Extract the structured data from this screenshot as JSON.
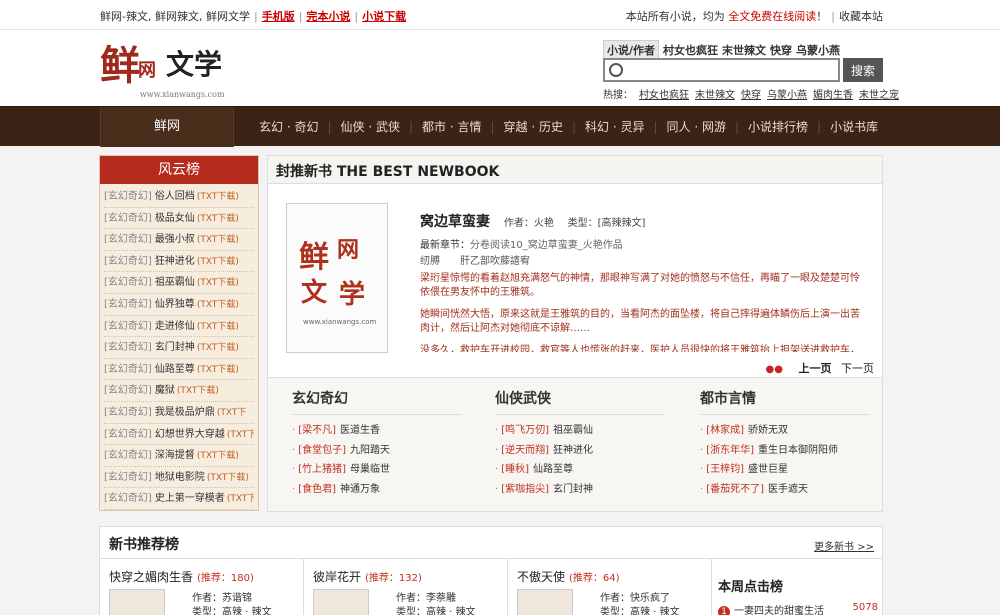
{
  "topbar": {
    "site_links": "鲜网-辣文, 鲜网辣文, 鲜网文学",
    "mobile": "手机版",
    "complete": "完本小说",
    "download": "小说下载",
    "notice_prefix": "本站所有小说，均为",
    "notice_free": "全文免费在线阅读",
    "notice_suffix": "！",
    "bookmark": "收藏本站"
  },
  "logo": {
    "char1": "鲜",
    "char2": "网",
    "text": "文学",
    "url": "www.xianwangs.com"
  },
  "search": {
    "tabs": [
      "小说/作者",
      "村女也疯狂",
      "末世辣文",
      "快穿",
      "乌蒙小燕"
    ],
    "value": "",
    "button": "搜索",
    "hot_label": "热搜：",
    "hot_items": [
      "村女也疯狂",
      "末世辣文",
      "快穿",
      "乌蒙小燕",
      "媚肉生香",
      "末世之宠"
    ]
  },
  "nav": {
    "home": "鲜网",
    "items": [
      "玄幻 · 奇幻",
      "仙侠 · 武侠",
      "都市 · 言情",
      "穿越 · 历史",
      "科幻 · 灵异",
      "同人 · 网游",
      "小说排行榜",
      "小说书库"
    ]
  },
  "rank": {
    "title": "风云榜",
    "items": [
      {
        "cat": "[玄幻奇幻]",
        "name": "俗人回档",
        "dl": "(TXT下载)"
      },
      {
        "cat": "[玄幻奇幻]",
        "name": "极品女仙",
        "dl": "(TXT下载)"
      },
      {
        "cat": "[玄幻奇幻]",
        "name": "最强小叔",
        "dl": "(TXT下载)"
      },
      {
        "cat": "[玄幻奇幻]",
        "name": "狂神进化",
        "dl": "(TXT下载)"
      },
      {
        "cat": "[玄幻奇幻]",
        "name": "祖巫霸仙",
        "dl": "(TXT下载)"
      },
      {
        "cat": "[玄幻奇幻]",
        "name": "仙界独尊",
        "dl": "(TXT下载)"
      },
      {
        "cat": "[玄幻奇幻]",
        "name": "走进修仙",
        "dl": "(TXT下载)"
      },
      {
        "cat": "[玄幻奇幻]",
        "name": "玄门封神",
        "dl": "(TXT下载)"
      },
      {
        "cat": "[玄幻奇幻]",
        "name": "仙路至尊",
        "dl": "(TXT下载)"
      },
      {
        "cat": "[玄幻奇幻]",
        "name": "魔狱",
        "dl": "(TXT下载)"
      },
      {
        "cat": "[玄幻奇幻]",
        "name": "我是极品炉鼎",
        "dl": "(TXT下"
      },
      {
        "cat": "[玄幻奇幻]",
        "name": "幻想世界大穿越",
        "dl": "(TXT下"
      },
      {
        "cat": "[玄幻奇幻]",
        "name": "深海提督",
        "dl": "(TXT下载)"
      },
      {
        "cat": "[玄幻奇幻]",
        "name": "地狱电影院",
        "dl": "(TXT下载)"
      },
      {
        "cat": "[玄幻奇幻]",
        "name": "史上第一穿模者",
        "dl": "(TXT下"
      }
    ]
  },
  "feature": {
    "heading": "封推新书 THE BEST NEWBOOK",
    "cover": {
      "c1": "鲜",
      "c2": "网",
      "c3": "文",
      "c4": "学",
      "c5": "www.xianwangs.com"
    },
    "title": "窝边草蛮妻",
    "author_label": "作者：",
    "author": "火艳",
    "type_label": "类型：",
    "type": "[高辣辣文]",
    "latest_label": "最新章节：",
    "latest": "分卷阅读10_窝边草蛮妻_火艳作品",
    "garble": "纫膊　　肝乙部吹藤譆宥",
    "desc": [
      "梁珩星惊愕的看着赵旭充满怒气的神情，那眼神写满了对她的愤怒与不信任，再瞄了一眼及楚楚可怜依偎在男友怀中的王雅筑。",
      "她瞬间恍然大悟，原来这就是王雅筑的目的，当看阿杰的面坠楼，将自己摔得遍体鳞伤后上演一出苦肉计，然后让阿杰对她彻底不谅解……",
      "没多久，救护车开进校园，救官等人也慌张的赶来，医护人员很快的将王雅筑抬上担架送进救护车，身为"
    ],
    "pager": {
      "dots": "●●",
      "prev": "上一页",
      "next": "下一页"
    }
  },
  "categories": [
    {
      "title": "玄幻奇幻",
      "items": [
        {
          "author": "[梁不凡]",
          "book": "医道生香"
        },
        {
          "author": "[食堂包子]",
          "book": "九阳踏天"
        },
        {
          "author": "[竹上猪猪]",
          "book": "母巢临世"
        },
        {
          "author": "[食色君]",
          "book": "神通万象"
        }
      ]
    },
    {
      "title": "仙侠武侠",
      "items": [
        {
          "author": "[鸣飞万仞]",
          "book": "祖巫霸仙"
        },
        {
          "author": "[逆天而翔]",
          "book": "狂神进化"
        },
        {
          "author": "[睡秋]",
          "book": "仙路至尊"
        },
        {
          "author": "[紫咖指尖]",
          "book": "玄门封神"
        }
      ]
    },
    {
      "title": "都市言情",
      "items": [
        {
          "author": "[林家成]",
          "book": "骄娇无双"
        },
        {
          "author": "[浙东年华]",
          "book": "重生日本御阴阳师"
        },
        {
          "author": "[王梓钧]",
          "book": "盛世巨星"
        },
        {
          "author": "[番茄死不了]",
          "book": "医手遮天"
        }
      ]
    }
  ],
  "newbooks": {
    "title": "新书推荐榜",
    "more": "更多新书  >>",
    "items": [
      {
        "name": "快穿之媚肉生香",
        "rec": "(推荐：180)",
        "author": "作者：苏谐锦",
        "type": "类型：高辣 · 辣文"
      },
      {
        "name": "彼岸花开",
        "rec": "(推荐：132)",
        "author": "作者：李萘雕",
        "type": "类型：高辣 · 辣文"
      },
      {
        "name": "不傲天使",
        "rec": "(推荐：64)",
        "author": "作者：快乐疯了",
        "type": "类型：高辣 · 辣文"
      }
    ],
    "weekly": {
      "title": "本周点击榜",
      "num": "1",
      "item": "一妻四夫的甜蜜生活",
      "count": "5078"
    }
  }
}
